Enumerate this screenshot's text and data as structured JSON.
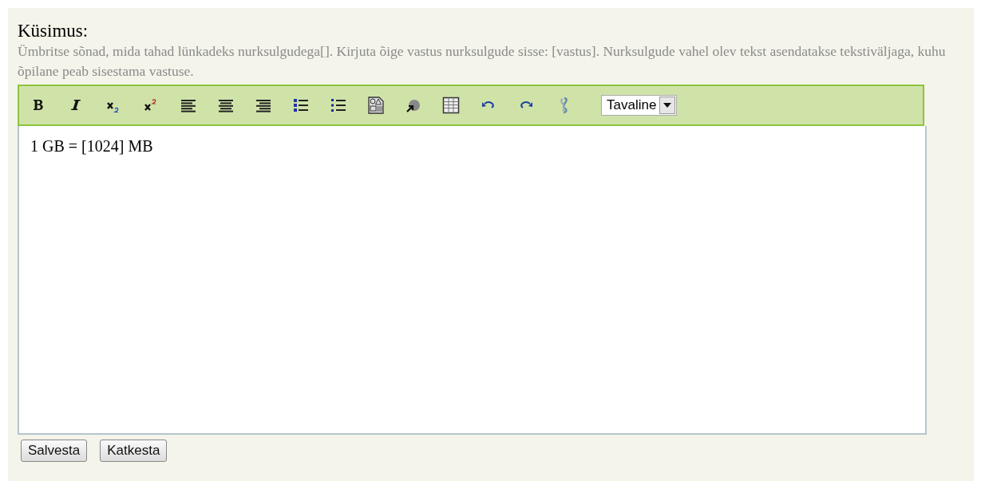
{
  "question": {
    "title": "Küsimus:",
    "hint": "Ümbritse sõnad, mida tahad lünkadeks nurksulgudega[]. Kirjuta õige vastus nurksulgude sisse: [vastus]. Nurksulgude vahel olev tekst asendatakse tekstiväljaga, kuhu õpilane peab sisestama vastuse."
  },
  "toolbar": {
    "tools": [
      {
        "kind": "bold"
      },
      {
        "kind": "italic"
      },
      {
        "kind": "subscript"
      },
      {
        "kind": "superscript"
      },
      {
        "kind": "align-left"
      },
      {
        "kind": "align-center"
      },
      {
        "kind": "align-right"
      },
      {
        "kind": "ordered-list"
      },
      {
        "kind": "bullet-list"
      },
      {
        "kind": "image"
      },
      {
        "kind": "media"
      },
      {
        "kind": "table"
      },
      {
        "kind": "undo"
      },
      {
        "kind": "redo"
      },
      {
        "kind": "link"
      }
    ],
    "format": "Tavaline"
  },
  "editor": {
    "content": "1 GB = [1024] MB"
  },
  "buttons": [
    "Salvesta",
    "Katkesta"
  ]
}
